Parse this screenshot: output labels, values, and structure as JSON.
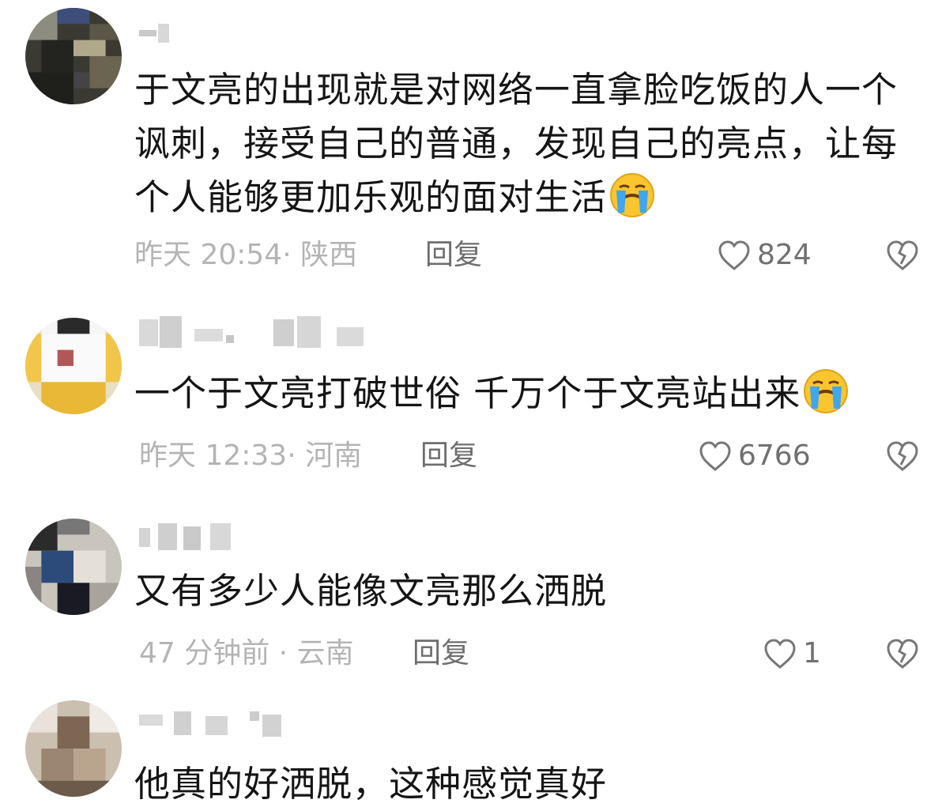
{
  "comments": [
    {
      "text": "于文亮的出现就是对网络一直拿脸吃饭的人一个讽刺，接受自己的普通，发现自己的亮点，让每个人能够更加乐观的面对生活",
      "emoji": "crying-face",
      "time": "昨天 20:54",
      "location": "陕西",
      "reply_label": "回复",
      "likes": "824"
    },
    {
      "text": "一个于文亮打破世俗 千万个于文亮站出来",
      "emoji": "crying-face",
      "time": "昨天 12:33",
      "location": "河南",
      "reply_label": "回复",
      "likes": "6766"
    },
    {
      "text": "又有多少人能像文亮那么洒脱",
      "time": "47 分钟前",
      "location": "云南",
      "reply_label": "回复",
      "likes": "1"
    },
    {
      "text": "他真的好洒脱，这种感觉真好"
    }
  ],
  "colors": {
    "meta": "#b4b4b4",
    "reply": "#6e6e6e",
    "text": "#151515"
  }
}
